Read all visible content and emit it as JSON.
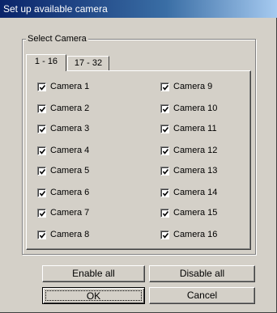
{
  "window": {
    "title": "Set up available camera"
  },
  "group": {
    "label": "Select Camera"
  },
  "tabs": [
    {
      "label": "1 - 16",
      "active": true
    },
    {
      "label": "17 - 32",
      "active": false
    }
  ],
  "cameras_left": [
    {
      "label": "Camera 1",
      "checked": true
    },
    {
      "label": "Camera 2",
      "checked": true
    },
    {
      "label": "Camera 3",
      "checked": true
    },
    {
      "label": "Camera 4",
      "checked": true
    },
    {
      "label": "Camera 5",
      "checked": true
    },
    {
      "label": "Camera 6",
      "checked": true
    },
    {
      "label": "Camera 7",
      "checked": true
    },
    {
      "label": "Camera 8",
      "checked": true
    }
  ],
  "cameras_right": [
    {
      "label": "Camera 9",
      "checked": true
    },
    {
      "label": "Camera 10",
      "checked": true
    },
    {
      "label": "Camera 11",
      "checked": true
    },
    {
      "label": "Camera 12",
      "checked": true
    },
    {
      "label": "Camera 13",
      "checked": true
    },
    {
      "label": "Camera 14",
      "checked": true
    },
    {
      "label": "Camera 15",
      "checked": true
    },
    {
      "label": "Camera 16",
      "checked": true
    }
  ],
  "buttons": {
    "enable_all": "Enable all",
    "disable_all": "Disable all",
    "ok": "OK",
    "cancel": "Cancel"
  }
}
